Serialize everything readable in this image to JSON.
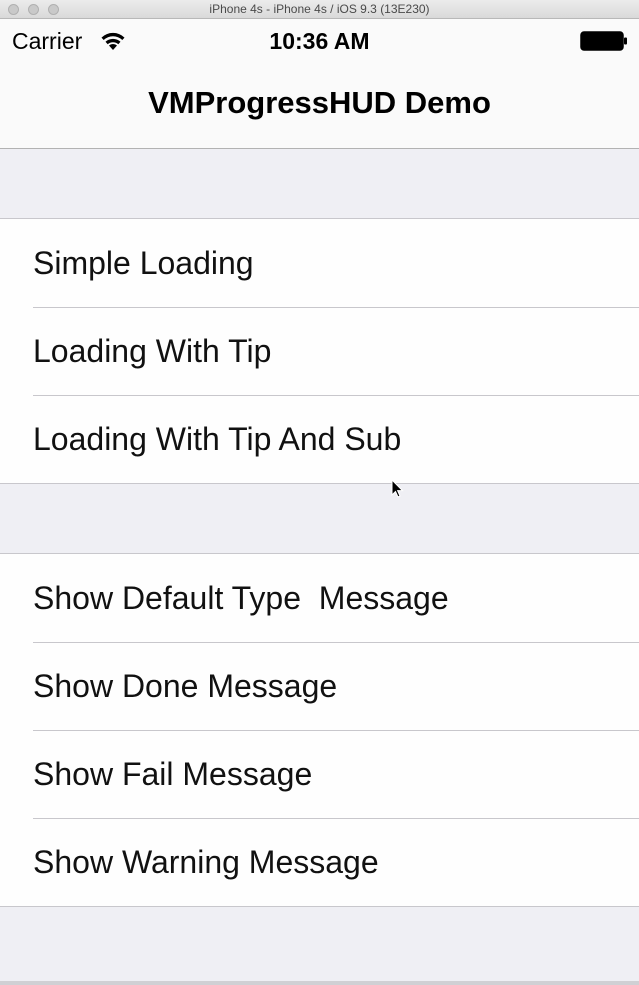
{
  "window": {
    "title": "iPhone 4s - iPhone 4s / iOS 9.3 (13E230)"
  },
  "status_bar": {
    "carrier": "Carrier",
    "time": "10:36 AM"
  },
  "nav": {
    "title": "VMProgressHUD Demo"
  },
  "sections": [
    {
      "rows": [
        "Simple Loading",
        "Loading With Tip",
        "Loading With Tip And Sub"
      ]
    },
    {
      "rows": [
        "Show Default Type  Message",
        "Show Done Message",
        "Show Fail Message",
        "Show Warning Message"
      ]
    }
  ],
  "icons": [
    "wifi-icon",
    "battery-icon",
    "cursor-icon"
  ]
}
